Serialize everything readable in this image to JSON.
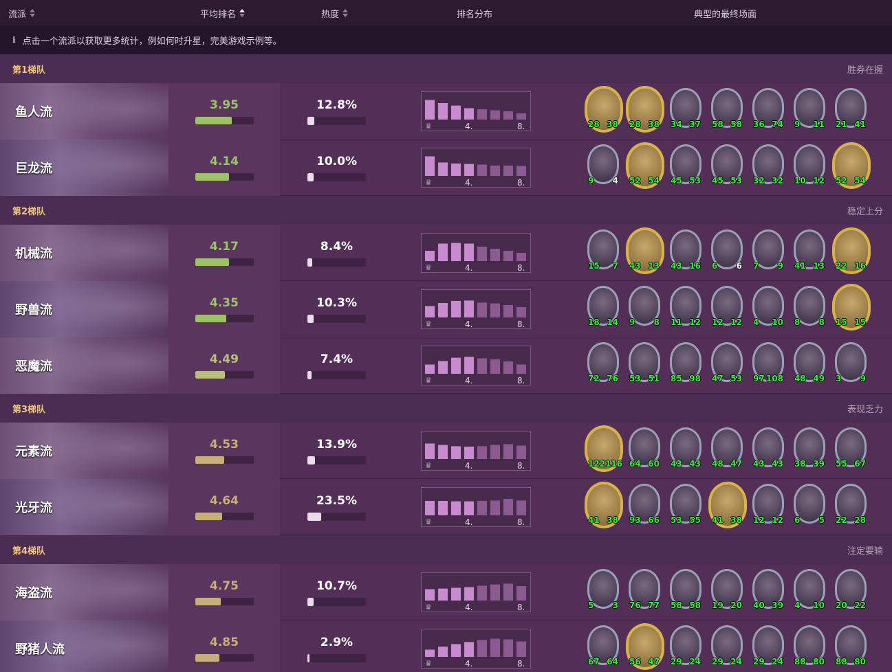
{
  "header": {
    "col_comp": "流派",
    "col_avg": "平均排名",
    "col_pop": "热度",
    "col_dist": "排名分布",
    "col_boards": "典型的最终场面"
  },
  "notice": "点击一个流派以获取更多统计，例如何时升星，完美游戏示例等。",
  "dist_labels": {
    "mid": "4.",
    "end": "8."
  },
  "tiers": [
    {
      "name": "第1梯队",
      "desc": "胜券在握",
      "comps": [
        {
          "name": "鱼人流",
          "avg": "3.95",
          "avg_fill": 0.62,
          "avg_color": "#9bc46a",
          "pop": "12.8%",
          "pop_fill": 0.12,
          "dist": [
            0.95,
            0.8,
            0.68,
            0.55,
            0.5,
            0.45,
            0.4,
            0.3
          ],
          "board": [
            {
              "a": "28",
              "h": "38",
              "gold": true
            },
            {
              "a": "28",
              "h": "38",
              "gold": true
            },
            {
              "a": "34",
              "h": "37"
            },
            {
              "a": "58",
              "h": "58"
            },
            {
              "a": "36",
              "h": "74"
            },
            {
              "a": "9",
              "h": "11"
            },
            {
              "a": "21",
              "h": "41"
            }
          ]
        },
        {
          "name": "巨龙流",
          "avg": "4.14",
          "avg_fill": 0.58,
          "avg_color": "#9bc46a",
          "pop": "10.0%",
          "pop_fill": 0.1,
          "dist": [
            0.95,
            0.65,
            0.6,
            0.58,
            0.55,
            0.5,
            0.5,
            0.48
          ],
          "board": [
            {
              "a": "9",
              "h": "4",
              "white": true
            },
            {
              "a": "52",
              "h": "54",
              "gold": true
            },
            {
              "a": "45",
              "h": "53"
            },
            {
              "a": "45",
              "h": "53"
            },
            {
              "a": "32",
              "h": "32"
            },
            {
              "a": "10",
              "h": "12"
            },
            {
              "a": "52",
              "h": "54",
              "gold": true
            }
          ]
        }
      ]
    },
    {
      "name": "第2梯队",
      "desc": "稳定上分",
      "comps": [
        {
          "name": "机械流",
          "avg": "4.17",
          "avg_fill": 0.58,
          "avg_color": "#9bc46a",
          "pop": "8.4%",
          "pop_fill": 0.08,
          "dist": [
            0.5,
            0.85,
            0.88,
            0.85,
            0.7,
            0.6,
            0.5,
            0.4
          ],
          "board": [
            {
              "a": "15",
              "h": "7"
            },
            {
              "a": "43",
              "h": "13",
              "gold": true
            },
            {
              "a": "43",
              "h": "16"
            },
            {
              "a": "6",
              "h": "6",
              "white": true
            },
            {
              "a": "7",
              "h": "9"
            },
            {
              "a": "41",
              "h": "13"
            },
            {
              "a": "22",
              "h": "16",
              "gold": true
            }
          ]
        },
        {
          "name": "野兽流",
          "avg": "4.35",
          "avg_fill": 0.53,
          "avg_color": "#9bc46a",
          "pop": "10.3%",
          "pop_fill": 0.1,
          "dist": [
            0.55,
            0.7,
            0.8,
            0.82,
            0.72,
            0.68,
            0.6,
            0.5
          ],
          "board": [
            {
              "a": "18",
              "h": "14"
            },
            {
              "a": "9",
              "h": "8"
            },
            {
              "a": "11",
              "h": "12"
            },
            {
              "a": "12",
              "h": "12"
            },
            {
              "a": "4",
              "h": "10"
            },
            {
              "a": "8",
              "h": "8"
            },
            {
              "a": "15",
              "h": "15",
              "gold": true
            }
          ]
        },
        {
          "name": "恶魔流",
          "avg": "4.49",
          "avg_fill": 0.5,
          "avg_color": "#b6c07a",
          "pop": "7.4%",
          "pop_fill": 0.07,
          "dist": [
            0.45,
            0.62,
            0.78,
            0.82,
            0.75,
            0.7,
            0.6,
            0.45
          ],
          "board": [
            {
              "a": "72",
              "h": "76"
            },
            {
              "a": "53",
              "h": "51"
            },
            {
              "a": "85",
              "h": "98"
            },
            {
              "a": "47",
              "h": "53"
            },
            {
              "a": "97",
              "h": "108"
            },
            {
              "a": "48",
              "h": "49"
            },
            {
              "a": "3",
              "h": "9"
            }
          ]
        }
      ]
    },
    {
      "name": "第3梯队",
      "desc": "表现乏力",
      "comps": [
        {
          "name": "元素流",
          "avg": "4.53",
          "avg_fill": 0.49,
          "avg_color": "#c9ae7a",
          "pop": "13.9%",
          "pop_fill": 0.13,
          "dist": [
            0.75,
            0.68,
            0.62,
            0.6,
            0.62,
            0.68,
            0.72,
            0.65
          ],
          "board": [
            {
              "a": "122",
              "h": "116",
              "gold": true
            },
            {
              "a": "64",
              "h": "60"
            },
            {
              "a": "43",
              "h": "43"
            },
            {
              "a": "48",
              "h": "47"
            },
            {
              "a": "43",
              "h": "43"
            },
            {
              "a": "38",
              "h": "39"
            },
            {
              "a": "55",
              "h": "67"
            }
          ]
        },
        {
          "name": "光牙流",
          "avg": "4.64",
          "avg_fill": 0.46,
          "avg_color": "#c9ae7a",
          "pop": "23.5%",
          "pop_fill": 0.23,
          "dist": [
            0.7,
            0.7,
            0.68,
            0.68,
            0.7,
            0.72,
            0.8,
            0.72
          ],
          "board": [
            {
              "a": "41",
              "h": "38",
              "gold": true
            },
            {
              "a": "93",
              "h": "66"
            },
            {
              "a": "53",
              "h": "55"
            },
            {
              "a": "41",
              "h": "38",
              "gold": true
            },
            {
              "a": "12",
              "h": "12"
            },
            {
              "a": "6",
              "h": "5"
            },
            {
              "a": "22",
              "h": "28"
            }
          ]
        }
      ]
    },
    {
      "name": "第4梯队",
      "desc": "注定要输",
      "comps": [
        {
          "name": "海盗流",
          "avg": "4.75",
          "avg_fill": 0.43,
          "avg_color": "#c9ae7a",
          "pop": "10.7%",
          "pop_fill": 0.1,
          "dist": [
            0.55,
            0.58,
            0.62,
            0.65,
            0.72,
            0.78,
            0.82,
            0.7
          ],
          "board": [
            {
              "a": "5",
              "h": "3"
            },
            {
              "a": "76",
              "h": "77"
            },
            {
              "a": "58",
              "h": "58"
            },
            {
              "a": "19",
              "h": "20"
            },
            {
              "a": "40",
              "h": "39"
            },
            {
              "a": "4",
              "h": "10"
            },
            {
              "a": "20",
              "h": "22"
            }
          ]
        },
        {
          "name": "野猪人流",
          "avg": "4.85",
          "avg_fill": 0.41,
          "avg_color": "#c9ae7a",
          "pop": "2.9%",
          "pop_fill": 0.03,
          "dist": [
            0.35,
            0.5,
            0.62,
            0.72,
            0.82,
            0.88,
            0.85,
            0.75
          ],
          "board": [
            {
              "a": "67",
              "h": "64"
            },
            {
              "a": "56",
              "h": "47",
              "gold": true
            },
            {
              "a": "29",
              "h": "24"
            },
            {
              "a": "29",
              "h": "24"
            },
            {
              "a": "29",
              "h": "24"
            },
            {
              "a": "88",
              "h": "80"
            },
            {
              "a": "88",
              "h": "80"
            }
          ]
        }
      ]
    }
  ]
}
